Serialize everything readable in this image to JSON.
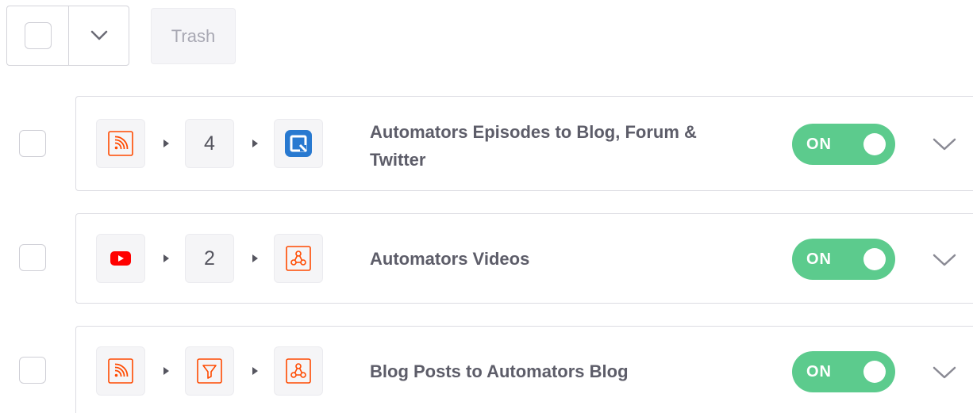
{
  "toolbar": {
    "trash_label": "Trash"
  },
  "zaps": [
    {
      "title": "Automators Episodes to Blog, Forum & Twitter",
      "trigger_icon": "rss-icon",
      "step_count": "4",
      "action_icon": "quip-icon",
      "toggle_label": "ON"
    },
    {
      "title": "Automators Videos",
      "trigger_icon": "youtube-icon",
      "step_count": "2",
      "action_icon": "webhook-icon",
      "toggle_label": "ON"
    },
    {
      "title": "Blog Posts to Automators Blog",
      "trigger_icon": "rss-icon",
      "step_icon": "filter-icon",
      "action_icon": "webhook-icon",
      "toggle_label": "ON"
    }
  ],
  "colors": {
    "toggle_on": "#5ccb8d",
    "zapier_orange": "#ff4a00",
    "youtube_red": "#ff0000",
    "quip_blue": "#2879d0",
    "title_text": "#5d5d69"
  }
}
